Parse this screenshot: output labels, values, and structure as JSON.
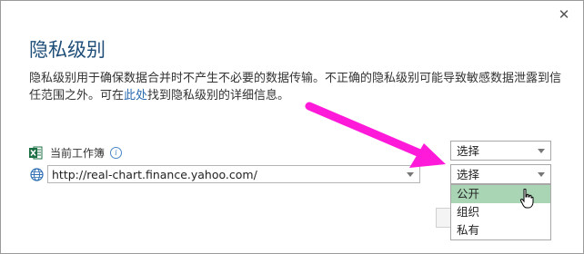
{
  "dialog": {
    "close_glyph": "✕",
    "title": "隐私级别",
    "description_part1": "隐私级别用于确保数据合并时不产生不必要的数据传输。不正确的隐私级别可能导致敏感数据泄露到信任范围之外。可在",
    "description_link": "此处",
    "description_part2": "找到隐私级别的详细信息。"
  },
  "current_workbook": {
    "icon": "excel-icon",
    "label": "当前工作簿",
    "info_icon_glyph": "i",
    "privacy_select_value": "选择"
  },
  "web_source": {
    "icon": "globe-icon",
    "url": "http://real-chart.finance.yahoo.com/",
    "privacy_select_value": "选择",
    "options": [
      "公开",
      "组织",
      "私有"
    ],
    "highlighted_option_index": 0
  },
  "colors": {
    "title": "#1f4e79",
    "link": "#2b6cb0",
    "highlight": "#a9d5b5",
    "annotation_arrow": "#ff1ad9",
    "excel_green": "#1d7044"
  }
}
